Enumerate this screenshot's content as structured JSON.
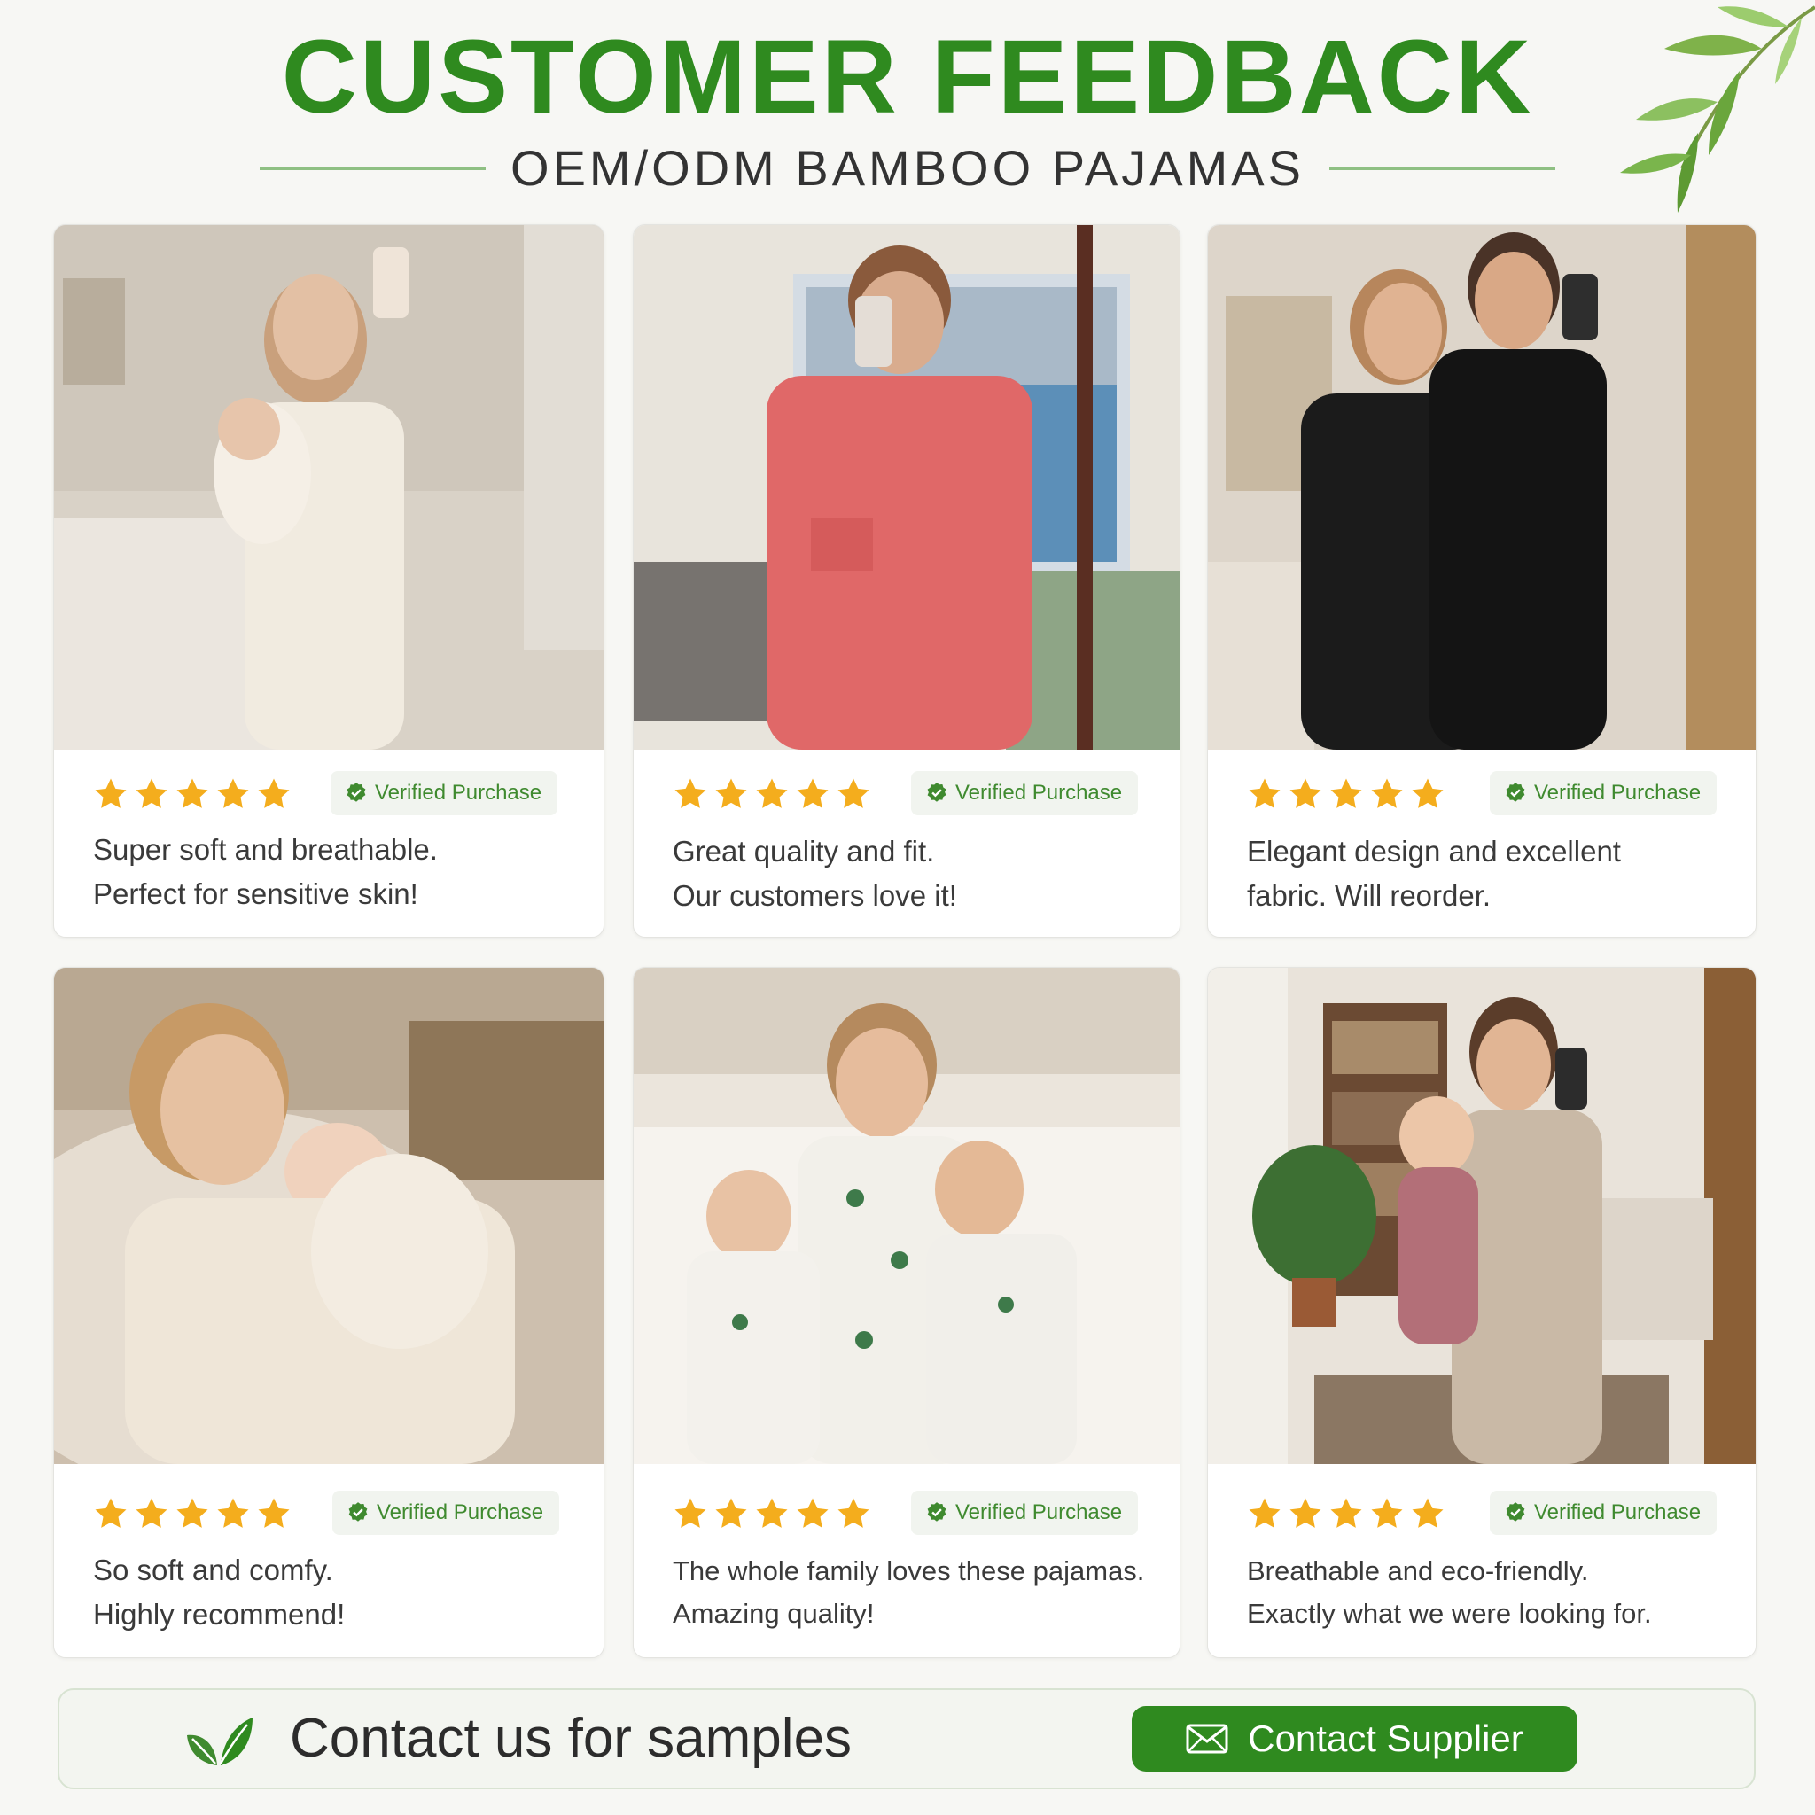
{
  "header": {
    "title": "CUSTOMER FEEDBACK",
    "subtitle": "OEM/ODM BAMBOO PAJAMAS"
  },
  "colors": {
    "brand_green": "#2f8a1f",
    "star_gold": "#f4ad1d",
    "badge_green": "#3f8a2f"
  },
  "reviews": [
    {
      "rating": 5,
      "badge": "Verified Purchase",
      "line1": "Super soft and breathable.",
      "line2": "Perfect for sensitive skin!"
    },
    {
      "rating": 5,
      "badge": "Verified Purchase",
      "line1": "Great quality and fit.",
      "line2": "Our customers love it!"
    },
    {
      "rating": 5,
      "badge": "Verified Purchase",
      "line1": "Elegant design and excellent",
      "line2": "fabric. Will reorder."
    },
    {
      "rating": 5,
      "badge": "Verified Purchase",
      "line1": "So soft and comfy.",
      "line2": "Highly recommend!"
    },
    {
      "rating": 5,
      "badge": "Verified Purchase",
      "line1": "The whole family loves these pajamas.",
      "line2": "Amazing quality!"
    },
    {
      "rating": 5,
      "badge": "Verified Purchase",
      "line1": "Breathable and eco-friendly.",
      "line2": "Exactly what we were looking for."
    }
  ],
  "footer": {
    "contact_text": "Contact us for samples",
    "button_label": "Contact Supplier",
    "leaf_icon": "leaf-icon",
    "mail_icon": "mail-icon"
  }
}
